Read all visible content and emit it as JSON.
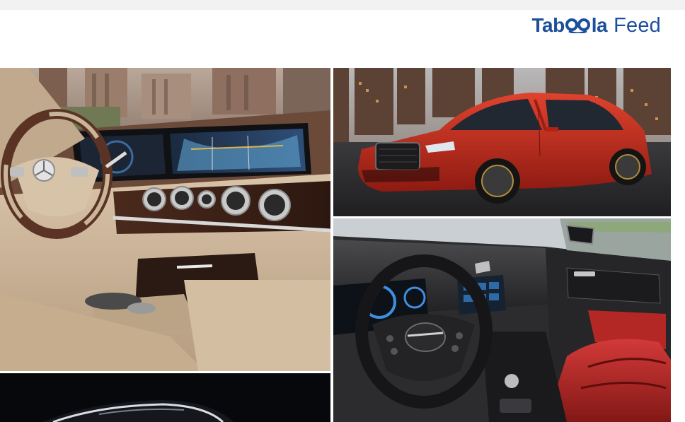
{
  "header": {
    "brand_name_start": "Tab",
    "brand_name_end": "la",
    "brand_suffix": "Feed",
    "brand_color": "#1b4f9c"
  },
  "feed": {
    "tiles": [
      {
        "icon": "mercedes-interior-photo"
      },
      {
        "icon": "red-chrysler-sedan-photo"
      },
      {
        "icon": "chrysler-interior-photo"
      },
      {
        "icon": "dark-luxury-car-photo"
      }
    ]
  }
}
